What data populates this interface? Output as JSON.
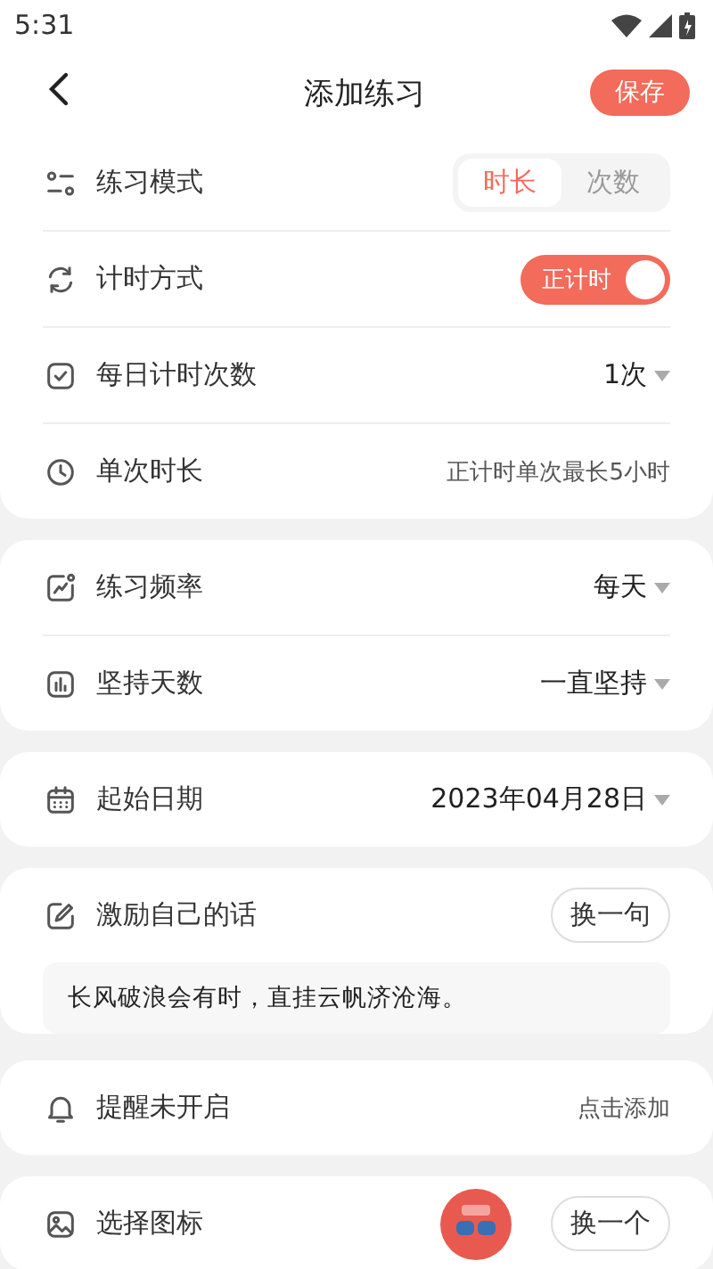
{
  "status_bar": {
    "time": "5:31"
  },
  "header": {
    "title": "添加练习",
    "save_button": "保存"
  },
  "sections": [
    {
      "rows": [
        {
          "kind": "segmented",
          "label": "练习模式",
          "options": [
            {
              "label": "时长",
              "selected": true
            },
            {
              "label": "次数",
              "selected": false
            }
          ]
        },
        {
          "kind": "toggle",
          "label": "计时方式",
          "toggle": {
            "label": "正计时",
            "on": true
          }
        },
        {
          "kind": "dropdown",
          "label": "每日计时次数",
          "value": "1次"
        },
        {
          "kind": "note",
          "label": "单次时长",
          "value": "正计时单次最长5小时"
        }
      ]
    },
    {
      "rows": [
        {
          "kind": "dropdown",
          "label": "练习频率",
          "value": "每天"
        },
        {
          "kind": "dropdown",
          "label": "坚持天数",
          "value": "一直坚持"
        }
      ]
    },
    {
      "rows": [
        {
          "kind": "dropdown",
          "label": "起始日期",
          "value": "2023年04月28日"
        }
      ]
    },
    {
      "rows": [
        {
          "kind": "button",
          "label": "激励自己的话",
          "button": "换一句"
        }
      ],
      "quote": "长风破浪会有时，直挂云帆济沧海。"
    },
    {
      "rows": [
        {
          "kind": "note",
          "label": "提醒未开启",
          "value": "点击添加"
        }
      ]
    },
    {
      "rows": [
        {
          "kind": "icon_button",
          "label": "选择图标",
          "button": "换一个"
        }
      ]
    }
  ]
}
